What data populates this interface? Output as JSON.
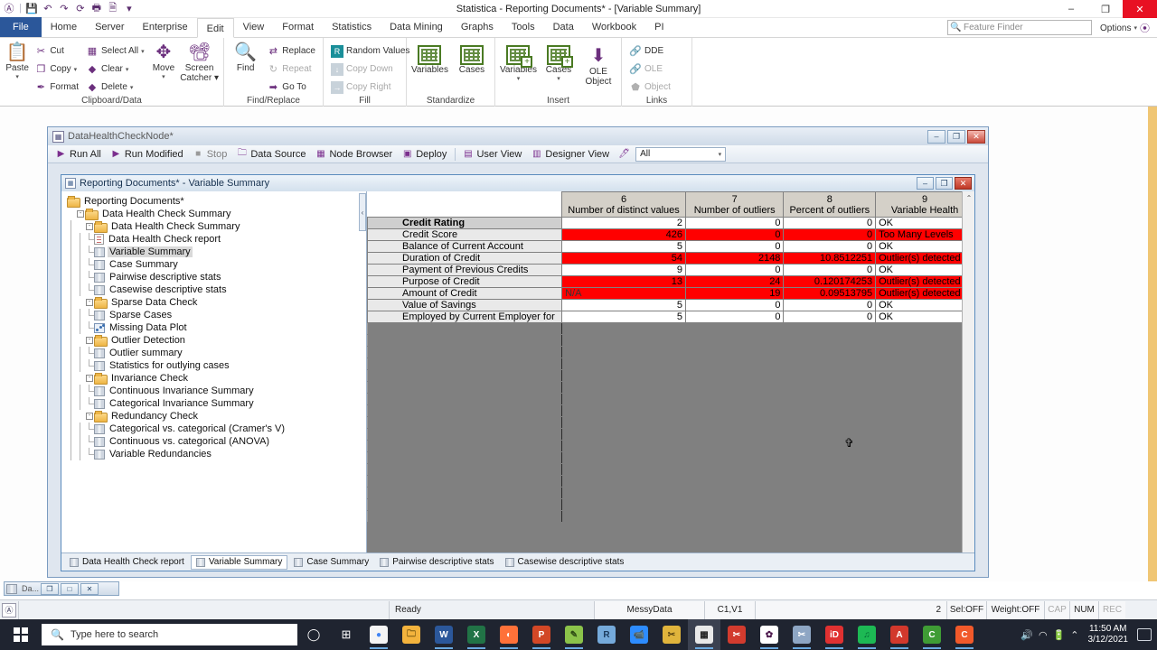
{
  "window": {
    "title": "Statistica - Reporting Documents* - [Variable Summary]",
    "minimize": "–",
    "maximize": "❐",
    "close": "✕"
  },
  "quick_access": {
    "items": [
      {
        "name": "statistica-logo-icon",
        "glyph": "Ⓐ"
      },
      {
        "name": "save-icon",
        "glyph": "💾"
      },
      {
        "name": "undo-icon",
        "glyph": "↶"
      },
      {
        "name": "redo-icon",
        "glyph": "↷"
      },
      {
        "name": "refresh-icon",
        "glyph": "⟳"
      },
      {
        "name": "print-icon",
        "glyph": "🖶"
      },
      {
        "name": "print-preview-icon",
        "glyph": "🗎"
      },
      {
        "name": "customize-qat-icon",
        "glyph": "▾"
      }
    ]
  },
  "ribbon": {
    "tabs": [
      {
        "label": "File",
        "active": false,
        "file": true
      },
      {
        "label": "Home",
        "active": false
      },
      {
        "label": "Server",
        "active": false
      },
      {
        "label": "Enterprise",
        "active": false
      },
      {
        "label": "Edit",
        "active": true
      },
      {
        "label": "View",
        "active": false
      },
      {
        "label": "Format",
        "active": false
      },
      {
        "label": "Statistics",
        "active": false
      },
      {
        "label": "Data Mining",
        "active": false
      },
      {
        "label": "Graphs",
        "active": false
      },
      {
        "label": "Tools",
        "active": false
      },
      {
        "label": "Data",
        "active": false
      },
      {
        "label": "Workbook",
        "active": false
      },
      {
        "label": "PI",
        "active": false
      }
    ],
    "feature_finder_placeholder": "Feature Finder",
    "options_label": "Options",
    "groups": {
      "clipboard": {
        "label": "Clipboard/Data",
        "paste": "Paste",
        "items": [
          {
            "label": "Cut",
            "icon": "scissors-icon",
            "glyph": "✂",
            "disabled": false,
            "caret": false
          },
          {
            "label": "Copy",
            "icon": "copy-icon",
            "glyph": "❐",
            "disabled": false,
            "caret": true
          },
          {
            "label": "Format",
            "icon": "format-painter-icon",
            "glyph": "✒",
            "disabled": false,
            "caret": false
          },
          {
            "label": "Select All",
            "icon": "select-all-icon",
            "glyph": "▦",
            "disabled": false,
            "caret": true
          },
          {
            "label": "Clear",
            "icon": "clear-icon",
            "glyph": "◆",
            "disabled": false,
            "caret": true
          },
          {
            "label": "Delete",
            "icon": "delete-icon",
            "glyph": "◆",
            "disabled": false,
            "caret": true
          }
        ],
        "move": "Move",
        "screen_catcher": "Screen\nCatcher"
      },
      "find_replace": {
        "label": "Find/Replace",
        "find": "Find",
        "items": [
          {
            "label": "Replace",
            "icon": "replace-icon",
            "glyph": "⇄",
            "disabled": false
          },
          {
            "label": "Repeat",
            "icon": "repeat-icon",
            "glyph": "↻",
            "disabled": true
          },
          {
            "label": "Go To",
            "icon": "goto-icon",
            "glyph": "➡",
            "disabled": false
          }
        ]
      },
      "fill": {
        "label": "Fill",
        "items": [
          {
            "label": "Random Values",
            "icon": "random-values-icon",
            "glyph": "R",
            "disabled": false
          },
          {
            "label": "Copy Down",
            "icon": "copy-down-icon",
            "glyph": "↓",
            "disabled": true
          },
          {
            "label": "Copy Right",
            "icon": "copy-right-icon",
            "glyph": "→",
            "disabled": true
          }
        ]
      },
      "standardize": {
        "label": "Standardize",
        "items": [
          {
            "label": "Variables",
            "icon": "variables-grid-icon"
          },
          {
            "label": "Cases",
            "icon": "cases-grid-icon"
          }
        ]
      },
      "insert": {
        "label": "Insert",
        "items": [
          {
            "label": "Variables",
            "icon": "insert-variables-icon",
            "caret": true
          },
          {
            "label": "Cases",
            "icon": "insert-cases-icon",
            "caret": true
          },
          {
            "label": "OLE\nObject",
            "icon": "ole-object-icon",
            "caret": false
          }
        ]
      },
      "links": {
        "label": "Links",
        "items": [
          {
            "label": "DDE",
            "icon": "dde-link-icon",
            "glyph": "🔗",
            "disabled": false
          },
          {
            "label": "OLE",
            "icon": "ole-link-icon",
            "glyph": "🔗",
            "disabled": true
          },
          {
            "label": "Object",
            "icon": "object-link-icon",
            "glyph": "⬟",
            "disabled": true
          }
        ]
      }
    }
  },
  "node_window": {
    "title": "DataHealthCheckNode*",
    "icon": "node-icon",
    "buttons": {
      "minimize": "–",
      "maximize": "❐",
      "close": "✕"
    },
    "toolbar": [
      {
        "label": "Run All",
        "icon": "run-all-icon",
        "glyph": "▶",
        "disabled": false
      },
      {
        "label": "Run Modified",
        "icon": "run-modified-icon",
        "glyph": "▶",
        "disabled": false
      },
      {
        "label": "Stop",
        "icon": "stop-icon",
        "glyph": "■",
        "disabled": true
      },
      {
        "label": "Data Source",
        "icon": "data-source-icon",
        "glyph": "🗀",
        "disabled": false
      },
      {
        "label": "Node Browser",
        "icon": "node-browser-icon",
        "glyph": "▦",
        "disabled": false
      },
      {
        "label": "Deploy",
        "icon": "deploy-icon",
        "glyph": "▣",
        "disabled": false
      },
      {
        "label": "User View",
        "icon": "user-view-icon",
        "glyph": "▤",
        "disabled": false
      },
      {
        "label": "Designer View",
        "icon": "designer-view-icon",
        "glyph": "▥",
        "disabled": false
      },
      {
        "label": "",
        "icon": "filter-icon",
        "glyph": "🖊",
        "disabled": false
      }
    ],
    "filter_value": "All"
  },
  "doc_window": {
    "title": "Reporting Documents* - Variable Summary",
    "icon": "workbook-icon",
    "buttons": {
      "minimize": "–",
      "maximize": "❐",
      "close": "✕"
    }
  },
  "tree": {
    "collapse_handle": "‹",
    "items": [
      {
        "label": "Reporting Documents*",
        "depth": 0,
        "type": "folder",
        "expander": "",
        "selected": false
      },
      {
        "label": "Data Health Check Summary",
        "depth": 1,
        "type": "folder",
        "expander": "-",
        "selected": false
      },
      {
        "label": "Data Health Check Summary",
        "depth": 2,
        "type": "folder",
        "expander": "-",
        "selected": false
      },
      {
        "label": "Data Health Check report",
        "depth": 3,
        "type": "report",
        "expander": "",
        "selected": false
      },
      {
        "label": "Variable Summary",
        "depth": 3,
        "type": "sheet",
        "expander": "",
        "selected": true
      },
      {
        "label": "Case Summary",
        "depth": 3,
        "type": "sheet",
        "expander": "",
        "selected": false
      },
      {
        "label": "Pairwise descriptive stats",
        "depth": 3,
        "type": "sheet",
        "expander": "",
        "selected": false
      },
      {
        "label": "Casewise descriptive stats",
        "depth": 3,
        "type": "sheet",
        "expander": "",
        "selected": false
      },
      {
        "label": "Sparse Data Check",
        "depth": 2,
        "type": "folder",
        "expander": "-",
        "selected": false
      },
      {
        "label": "Sparse Cases",
        "depth": 3,
        "type": "sheet",
        "expander": "",
        "selected": false
      },
      {
        "label": "Missing Data Plot",
        "depth": 3,
        "type": "plot",
        "expander": "",
        "selected": false
      },
      {
        "label": "Outlier Detection",
        "depth": 2,
        "type": "folder",
        "expander": "-",
        "selected": false
      },
      {
        "label": "Outlier summary",
        "depth": 3,
        "type": "sheet",
        "expander": "",
        "selected": false
      },
      {
        "label": "Statistics for outlying cases",
        "depth": 3,
        "type": "sheet",
        "expander": "",
        "selected": false
      },
      {
        "label": "Invariance Check",
        "depth": 2,
        "type": "folder",
        "expander": "-",
        "selected": false
      },
      {
        "label": "Continuous Invariance Summary",
        "depth": 3,
        "type": "sheet",
        "expander": "",
        "selected": false
      },
      {
        "label": "Categorical Invariance Summary",
        "depth": 3,
        "type": "sheet",
        "expander": "",
        "selected": false
      },
      {
        "label": "Redundancy Check",
        "depth": 2,
        "type": "folder",
        "expander": "-",
        "selected": false
      },
      {
        "label": "Categorical vs. categorical (Cramer's V)",
        "depth": 3,
        "type": "sheet",
        "expander": "",
        "selected": false
      },
      {
        "label": "Continuous vs. categorical (ANOVA)",
        "depth": 3,
        "type": "sheet",
        "expander": "",
        "selected": false
      },
      {
        "label": "Variable Redundancies",
        "depth": 3,
        "type": "sheet",
        "expander": "",
        "selected": false
      }
    ]
  },
  "spreadsheet": {
    "columns": [
      {
        "number": "6",
        "name": "Number of distinct values"
      },
      {
        "number": "7",
        "name": "Number of outliers"
      },
      {
        "number": "8",
        "name": "Percent of outliers"
      },
      {
        "number": "9",
        "name": "Variable Health"
      }
    ],
    "rows": [
      {
        "header": "Credit Rating",
        "first": true,
        "alert": false,
        "cells": [
          "2",
          "0",
          "0",
          "OK"
        ]
      },
      {
        "header": "Credit Score",
        "first": false,
        "alert": true,
        "cells": [
          "426",
          "0",
          "0",
          "Too Many Levels"
        ]
      },
      {
        "header": "Balance of Current Account",
        "first": false,
        "alert": false,
        "cells": [
          "5",
          "0",
          "0",
          "OK"
        ]
      },
      {
        "header": "Duration of Credit",
        "first": false,
        "alert": true,
        "cells": [
          "54",
          "2148",
          "10.8512251",
          "Outlier(s) detected"
        ]
      },
      {
        "header": "Payment of Previous Credits",
        "first": false,
        "alert": false,
        "cells": [
          "9",
          "0",
          "0",
          "OK"
        ]
      },
      {
        "header": "Purpose of Credit",
        "first": false,
        "alert": true,
        "cells": [
          "13",
          "24",
          "0.120174253",
          "Outlier(s) detected"
        ]
      },
      {
        "header": "Amount of Credit",
        "first": false,
        "alert": true,
        "cells": [
          "N/A",
          "19",
          "0.09513795",
          "Outlier(s) detected"
        ]
      },
      {
        "header": "Value of Savings",
        "first": false,
        "alert": false,
        "cells": [
          "5",
          "0",
          "0",
          "OK"
        ]
      },
      {
        "header": "Employed by Current Employer for",
        "first": false,
        "alert": false,
        "cells": [
          "5",
          "0",
          "0",
          "OK"
        ]
      }
    ],
    "scroll": {
      "up_arrow": "⌃",
      "down_arrow": "⌄",
      "left_arrow": "‹",
      "right_arrow": "›",
      "grip": "◢"
    }
  },
  "doc_tabs": [
    {
      "label": "Data Health Check report",
      "active": false
    },
    {
      "label": "Variable Summary",
      "active": true
    },
    {
      "label": "Case Summary",
      "active": false
    },
    {
      "label": "Pairwise descriptive stats",
      "active": false
    },
    {
      "label": "Casewise descriptive stats",
      "active": false
    }
  ],
  "mdi_bar": {
    "label": "Da...",
    "restore": "❐",
    "maximize": "□",
    "close": "✕"
  },
  "status_bar": {
    "app_icon": "statistica-icon",
    "message": "",
    "ready": "Ready",
    "dataset": "MessyData",
    "cell_ref": "C1,V1",
    "value": "2",
    "sel": "Sel:OFF",
    "weight": "Weight:OFF",
    "cap": "CAP",
    "num": "NUM",
    "rec": "REC"
  },
  "taskbar": {
    "search_placeholder": "Type here to search",
    "cortana_icon": "cortana-icon",
    "taskview_icon": "task-view-icon",
    "apps": [
      {
        "name": "chrome-icon",
        "glyph": "●",
        "color": "#f5f5f5",
        "text": "#4285f4",
        "open": true,
        "active": false
      },
      {
        "name": "file-explorer-icon",
        "glyph": "🗀",
        "color": "#f3b33d",
        "text": "#7a5a12",
        "open": false,
        "active": false
      },
      {
        "name": "word-icon",
        "glyph": "W",
        "color": "#2b579a",
        "text": "#ffffff",
        "open": true,
        "active": false
      },
      {
        "name": "excel-icon",
        "glyph": "X",
        "color": "#217346",
        "text": "#ffffff",
        "open": true,
        "active": false
      },
      {
        "name": "firefox-icon",
        "glyph": "◐",
        "color": "#ff7139",
        "text": "#ffffff",
        "open": true,
        "active": false
      },
      {
        "name": "powerpoint-icon",
        "glyph": "P",
        "color": "#d24726",
        "text": "#ffffff",
        "open": true,
        "active": false
      },
      {
        "name": "notes-icon",
        "glyph": "✎",
        "color": "#8bc34a",
        "text": "#2d4a14",
        "open": true,
        "active": false
      },
      {
        "name": "rstudio-icon",
        "glyph": "R",
        "color": "#75aadb",
        "text": "#1b3a5c",
        "open": false,
        "active": false
      },
      {
        "name": "zoom-icon",
        "glyph": "📹",
        "color": "#2d8cff",
        "text": "#ffffff",
        "open": false,
        "active": false
      },
      {
        "name": "snip-tool-icon",
        "glyph": "✂",
        "color": "#e0b43c",
        "text": "#5a4410",
        "open": false,
        "active": false
      },
      {
        "name": "statistica-icon",
        "glyph": "▦",
        "color": "#e8e8e8",
        "text": "#222222",
        "open": true,
        "active": true
      },
      {
        "name": "sas-icon",
        "glyph": "✂",
        "color": "#d23b2e",
        "text": "#ffffff",
        "open": false,
        "active": false
      },
      {
        "name": "slack-icon",
        "glyph": "✿",
        "color": "#ffffff",
        "text": "#4a154b",
        "open": true,
        "active": false
      },
      {
        "name": "snagit-icon",
        "glyph": "✂",
        "color": "#8ea6c4",
        "text": "#ffffff",
        "open": true,
        "active": false
      },
      {
        "name": "idrive-icon",
        "glyph": "iD",
        "color": "#e03131",
        "text": "#ffffff",
        "open": true,
        "active": false
      },
      {
        "name": "spotify-icon",
        "glyph": "♫",
        "color": "#1db954",
        "text": "#063",
        "open": true,
        "active": false
      },
      {
        "name": "acrobat-icon",
        "glyph": "A",
        "color": "#d2382c",
        "text": "#ffffff",
        "open": true,
        "active": false
      },
      {
        "name": "camtasia-icon",
        "glyph": "C",
        "color": "#3f9c35",
        "text": "#ffffff",
        "open": true,
        "active": false
      },
      {
        "name": "camtasia-editor-icon",
        "glyph": "C",
        "color": "#f1592a",
        "text": "#ffffff",
        "open": true,
        "active": false
      }
    ],
    "tray": [
      {
        "name": "show-hidden-icons-icon",
        "glyph": "⌃"
      },
      {
        "name": "battery-icon",
        "glyph": "🔋"
      },
      {
        "name": "wifi-icon",
        "glyph": "◠"
      },
      {
        "name": "volume-icon",
        "glyph": "🔊"
      }
    ],
    "time": "11:50 AM",
    "date": "3/12/2021",
    "action_center_icon": "action-center-icon"
  }
}
